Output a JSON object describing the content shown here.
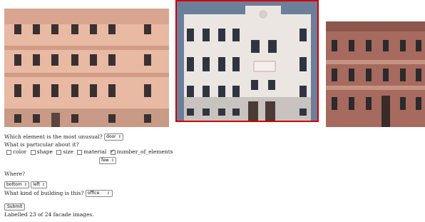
{
  "images": [
    {
      "name": "facade-image-1",
      "selected": false
    },
    {
      "name": "facade-image-2",
      "selected": true
    },
    {
      "name": "facade-image-3",
      "selected": false
    }
  ],
  "question_unusual": {
    "label": "Which element is the most unusual?",
    "value": "door"
  },
  "question_particular": {
    "label": "What is particular about it?",
    "options": [
      {
        "label": "color",
        "checked": false
      },
      {
        "label": "shape",
        "checked": false
      },
      {
        "label": "size",
        "checked": false
      },
      {
        "label": "material",
        "checked": false
      },
      {
        "label": "number_of_elements",
        "checked": true
      }
    ],
    "count_value": "few"
  },
  "question_where": {
    "label": "Where?",
    "vertical": "bottom",
    "horizontal": "left"
  },
  "question_building": {
    "label": "What kind of building is this?",
    "value": "office"
  },
  "submit_label": "Submit",
  "status": "Labelled 23 of 24 facade images.",
  "colors": {
    "selection_border": "#d40000"
  }
}
